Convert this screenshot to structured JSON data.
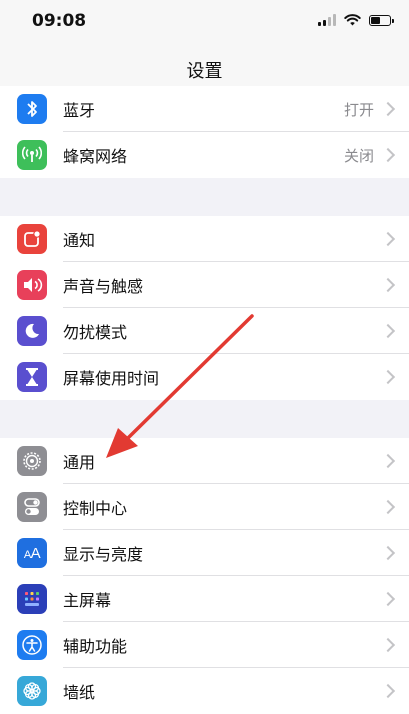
{
  "status_bar": {
    "time": "09:08"
  },
  "header": {
    "title": "设置"
  },
  "groups": [
    {
      "items": [
        {
          "label": "蓝牙",
          "value": "打开",
          "icon": "bluetooth-icon",
          "color": "#1e7cf0"
        },
        {
          "label": "蜂窝网络",
          "value": "关闭",
          "icon": "cellular-icon",
          "color": "#3ebf5a"
        }
      ]
    },
    {
      "items": [
        {
          "label": "通知",
          "value": "",
          "icon": "notifications-icon",
          "color": "#e9433c"
        },
        {
          "label": "声音与触感",
          "value": "",
          "icon": "sound-icon",
          "color": "#e8405a"
        },
        {
          "label": "勿扰模式",
          "value": "",
          "icon": "moon-icon",
          "color": "#5a4fcf"
        },
        {
          "label": "屏幕使用时间",
          "value": "",
          "icon": "hourglass-icon",
          "color": "#5a4fcf"
        }
      ]
    },
    {
      "items": [
        {
          "label": "通用",
          "value": "",
          "icon": "gear-icon",
          "color": "#8e8e93"
        },
        {
          "label": "控制中心",
          "value": "",
          "icon": "switches-icon",
          "color": "#8e8e93"
        },
        {
          "label": "显示与亮度",
          "value": "",
          "icon": "display-icon",
          "color": "#1f6fe0"
        },
        {
          "label": "主屏幕",
          "value": "",
          "icon": "home-screen-icon",
          "color": "#2b3fb8"
        },
        {
          "label": "辅助功能",
          "value": "",
          "icon": "accessibility-icon",
          "color": "#1e7cf0"
        },
        {
          "label": "墙纸",
          "value": "",
          "icon": "wallpaper-icon",
          "color": "#37a8d8"
        }
      ]
    }
  ],
  "annotation": {
    "color": "#e23a32",
    "target": "通用"
  }
}
